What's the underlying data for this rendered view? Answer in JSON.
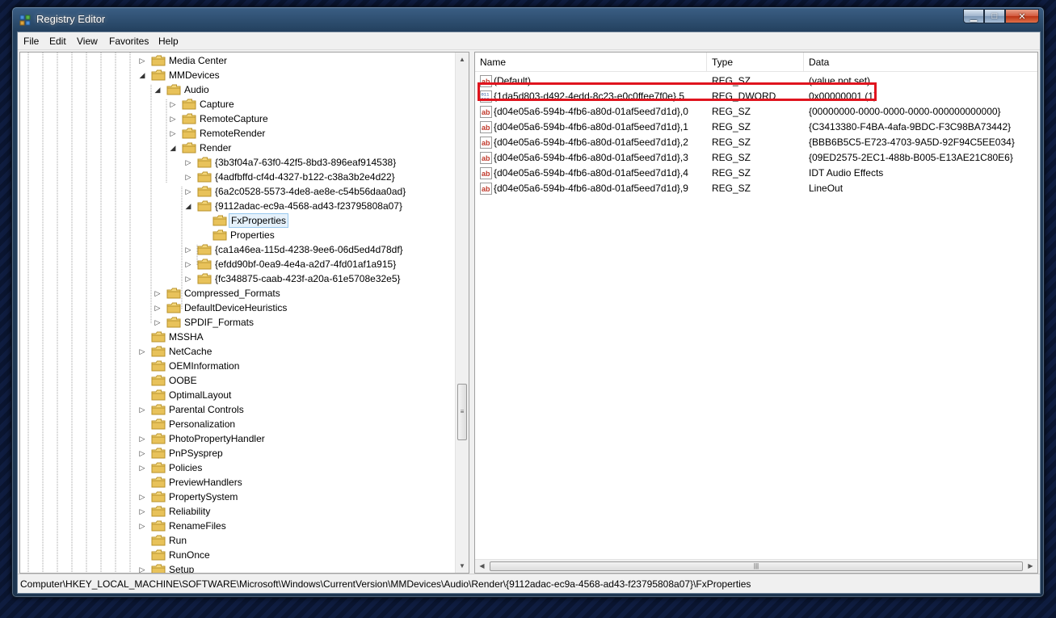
{
  "window": {
    "title": "Registry Editor",
    "caption_buttons": {
      "minimize": "▁",
      "maximize": "□",
      "close": "✕"
    }
  },
  "menu": [
    "File",
    "Edit",
    "View",
    "Favorites",
    "Help"
  ],
  "tree": [
    {
      "label": "Media Center",
      "depth": 0,
      "state": "collapsed"
    },
    {
      "label": "MMDevices",
      "depth": 0,
      "state": "expanded"
    },
    {
      "label": "Audio",
      "depth": 1,
      "state": "expanded"
    },
    {
      "label": "Capture",
      "depth": 2,
      "state": "collapsed"
    },
    {
      "label": "RemoteCapture",
      "depth": 2,
      "state": "collapsed"
    },
    {
      "label": "RemoteRender",
      "depth": 2,
      "state": "collapsed"
    },
    {
      "label": "Render",
      "depth": 2,
      "state": "expanded"
    },
    {
      "label": "{3b3f04a7-63f0-42f5-8bd3-896eaf914538}",
      "depth": 3,
      "state": "collapsed"
    },
    {
      "label": "{4adfbffd-cf4d-4327-b122-c38a3b2e4d22}",
      "depth": 3,
      "state": "collapsed"
    },
    {
      "label": "{6a2c0528-5573-4de8-ae8e-c54b56daa0ad}",
      "depth": 3,
      "state": "collapsed"
    },
    {
      "label": "{9112adac-ec9a-4568-ad43-f23795808a07}",
      "depth": 3,
      "state": "expanded"
    },
    {
      "label": "FxProperties",
      "depth": 4,
      "state": "leaf",
      "selected": true
    },
    {
      "label": "Properties",
      "depth": 4,
      "state": "leaf"
    },
    {
      "label": "{ca1a46ea-115d-4238-9ee6-06d5ed4d78df}",
      "depth": 3,
      "state": "collapsed"
    },
    {
      "label": "{efdd90bf-0ea9-4e4a-a2d7-4fd01af1a915}",
      "depth": 3,
      "state": "collapsed"
    },
    {
      "label": "{fc348875-caab-423f-a20a-61e5708e32e5}",
      "depth": 3,
      "state": "collapsed"
    },
    {
      "label": "Compressed_Formats",
      "depth": 1,
      "state": "collapsed"
    },
    {
      "label": "DefaultDeviceHeuristics",
      "depth": 1,
      "state": "collapsed"
    },
    {
      "label": "SPDIF_Formats",
      "depth": 1,
      "state": "collapsed"
    },
    {
      "label": "MSSHA",
      "depth": 0,
      "state": "leaf"
    },
    {
      "label": "NetCache",
      "depth": 0,
      "state": "collapsed"
    },
    {
      "label": "OEMInformation",
      "depth": 0,
      "state": "leaf"
    },
    {
      "label": "OOBE",
      "depth": 0,
      "state": "leaf"
    },
    {
      "label": "OptimalLayout",
      "depth": 0,
      "state": "leaf"
    },
    {
      "label": "Parental Controls",
      "depth": 0,
      "state": "collapsed"
    },
    {
      "label": "Personalization",
      "depth": 0,
      "state": "leaf"
    },
    {
      "label": "PhotoPropertyHandler",
      "depth": 0,
      "state": "collapsed"
    },
    {
      "label": "PnPSysprep",
      "depth": 0,
      "state": "collapsed"
    },
    {
      "label": "Policies",
      "depth": 0,
      "state": "collapsed"
    },
    {
      "label": "PreviewHandlers",
      "depth": 0,
      "state": "leaf"
    },
    {
      "label": "PropertySystem",
      "depth": 0,
      "state": "collapsed"
    },
    {
      "label": "Reliability",
      "depth": 0,
      "state": "collapsed"
    },
    {
      "label": "RenameFiles",
      "depth": 0,
      "state": "collapsed"
    },
    {
      "label": "Run",
      "depth": 0,
      "state": "leaf"
    },
    {
      "label": "RunOnce",
      "depth": 0,
      "state": "leaf"
    },
    {
      "label": "Setup",
      "depth": 0,
      "state": "collapsed"
    }
  ],
  "list": {
    "columns": [
      "Name",
      "Type",
      "Data"
    ],
    "rows": [
      {
        "icon": "string-value-icon",
        "name": "(Default)",
        "type": "REG_SZ",
        "data": "(value not set)"
      },
      {
        "icon": "dword-value-icon",
        "name": "{1da5d803-d492-4edd-8c23-e0c0ffee7f0e},5",
        "type": "REG_DWORD",
        "data": "0x00000001 (1)",
        "highlighted": true
      },
      {
        "icon": "string-value-icon",
        "name": "{d04e05a6-594b-4fb6-a80d-01af5eed7d1d},0",
        "type": "REG_SZ",
        "data": "{00000000-0000-0000-0000-000000000000}"
      },
      {
        "icon": "string-value-icon",
        "name": "{d04e05a6-594b-4fb6-a80d-01af5eed7d1d},1",
        "type": "REG_SZ",
        "data": "{C3413380-F4BA-4afa-9BDC-F3C98BA73442}"
      },
      {
        "icon": "string-value-icon",
        "name": "{d04e05a6-594b-4fb6-a80d-01af5eed7d1d},2",
        "type": "REG_SZ",
        "data": "{BBB6B5C5-E723-4703-9A5D-92F94C5EE034}"
      },
      {
        "icon": "string-value-icon",
        "name": "{d04e05a6-594b-4fb6-a80d-01af5eed7d1d},3",
        "type": "REG_SZ",
        "data": "{09ED2575-2EC1-488b-B005-E13AE21C80E6}"
      },
      {
        "icon": "string-value-icon",
        "name": "{d04e05a6-594b-4fb6-a80d-01af5eed7d1d},4",
        "type": "REG_SZ",
        "data": "IDT Audio Effects"
      },
      {
        "icon": "string-value-icon",
        "name": "{d04e05a6-594b-4fb6-a80d-01af5eed7d1d},9",
        "type": "REG_SZ",
        "data": "LineOut"
      }
    ]
  },
  "statusbar": {
    "path": "Computer\\HKEY_LOCAL_MACHINE\\SOFTWARE\\Microsoft\\Windows\\CurrentVersion\\MMDevices\\Audio\\Render\\{9112adac-ec9a-4568-ad43-f23795808a07}\\FxProperties"
  },
  "colors": {
    "highlight_border": "#e0141e",
    "folder": "#e8c25a",
    "selection": "#e5f1fb"
  }
}
